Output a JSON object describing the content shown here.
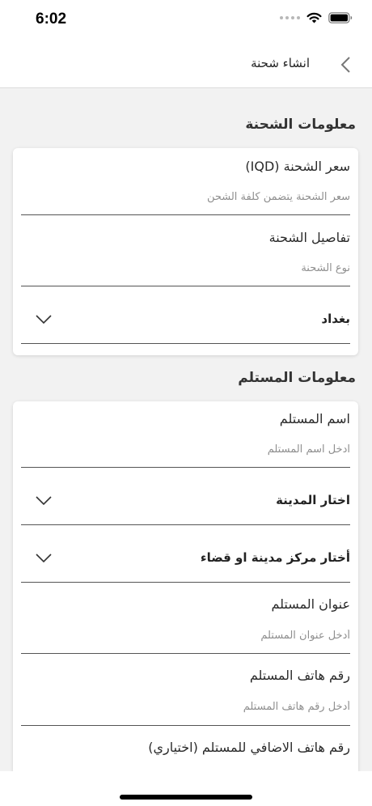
{
  "status": {
    "time": "6:02"
  },
  "nav": {
    "title": "انشاء شحنة"
  },
  "shipment": {
    "section_title": "معلومات الشحنة",
    "price": {
      "label": "سعر الشحنة (IQD)",
      "placeholder": "سعر الشحنة يتضمن كلفة الشحن",
      "value": ""
    },
    "details": {
      "label": "تفاصيل الشحنة",
      "placeholder": "نوع الشحنة",
      "value": ""
    },
    "governorate": {
      "selected": "بغداد"
    }
  },
  "receiver": {
    "section_title": "معلومات المستلم",
    "name": {
      "label": "اسم المستلم",
      "placeholder": "ادخل اسم المستلم",
      "value": ""
    },
    "city": {
      "selected": "اختار المدينة"
    },
    "district": {
      "selected": "أختار مركز مدينة او قضاء"
    },
    "address": {
      "label": "عنوان المستلم",
      "placeholder": "أدخل عنوان المستلم",
      "value": ""
    },
    "phone": {
      "label": "رقم هاتف المستلم",
      "placeholder": "أدخل رقم هاتف المستلم",
      "value": ""
    },
    "extra_phone": {
      "label": "رقم هاتف الاضافي للمستلم (اختياري)"
    }
  },
  "icons": {
    "back": "chevron-left-icon",
    "dropdown": "chevron-down-icon",
    "wifi": "wifi-icon",
    "battery": "battery-icon",
    "signal": "cellular-signal-icon"
  }
}
